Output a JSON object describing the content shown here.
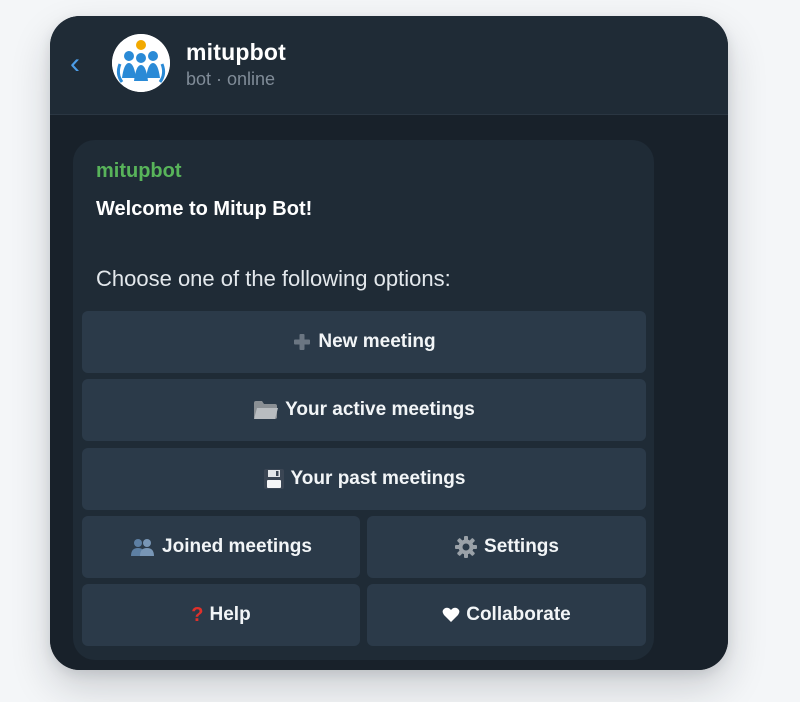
{
  "header": {
    "title": "mitupbot",
    "subtitle": "bot · online"
  },
  "message": {
    "sender": "mitupbot",
    "welcome": "Welcome to Mitup Bot!",
    "prompt": "Choose one of the following options:"
  },
  "keyboard": {
    "new_meeting": "New meeting",
    "active_meetings": "Your active meetings",
    "past_meetings": "Your past meetings",
    "joined_meetings": "Joined meetings",
    "settings": "Settings",
    "help": "Help",
    "collaborate": "Collaborate"
  },
  "icons": {
    "back": "chevron-left-icon",
    "avatar": "people-logo-icon",
    "new_meeting": "plus-icon",
    "active_meetings": "folder-icon",
    "past_meetings": "floppy-disk-icon",
    "joined_meetings": "people-icon",
    "settings": "gear-icon",
    "help": "question-mark-icon",
    "collaborate": "heart-icon"
  },
  "colors": {
    "accent": "#4c9ce6",
    "sender": "#58b45a",
    "background": "#1a232d",
    "button": "#2b3a49"
  }
}
